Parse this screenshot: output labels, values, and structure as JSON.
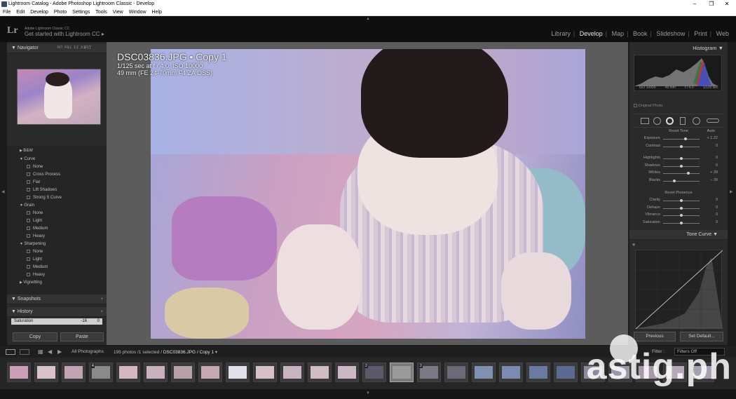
{
  "window": {
    "title": "Lightroom Catalog - Adobe Photoshop Lightroom Classic - Develop",
    "controls": [
      "–",
      "❐",
      "✕"
    ]
  },
  "menu": [
    "File",
    "Edit",
    "Develop",
    "Photo",
    "Settings",
    "Tools",
    "View",
    "Window",
    "Help"
  ],
  "identity": {
    "logo": "Lr",
    "line1": "Adobe Lightroom Classic CC",
    "line2": "Get started with Lightroom CC ▸"
  },
  "modules": [
    {
      "label": "Library",
      "active": false
    },
    {
      "label": "Develop",
      "active": true
    },
    {
      "label": "Map",
      "active": false
    },
    {
      "label": "Book",
      "active": false
    },
    {
      "label": "Slideshow",
      "active": false
    },
    {
      "label": "Print",
      "active": false
    },
    {
      "label": "Web",
      "active": false
    }
  ],
  "navigator": {
    "title": "Navigator",
    "zoom": [
      "FIT",
      "FILL",
      "1:1",
      "3:1"
    ]
  },
  "presets": [
    {
      "label": "B&W",
      "type": "folder",
      "open": false
    },
    {
      "label": "Curve",
      "type": "folder",
      "open": true
    },
    {
      "label": "None",
      "type": "item"
    },
    {
      "label": "Cross Process",
      "type": "item"
    },
    {
      "label": "Flat",
      "type": "item"
    },
    {
      "label": "Lift Shadows",
      "type": "item"
    },
    {
      "label": "Strong S Curve",
      "type": "item"
    },
    {
      "label": "Grain",
      "type": "folder",
      "open": true
    },
    {
      "label": "None",
      "type": "item"
    },
    {
      "label": "Light",
      "type": "item"
    },
    {
      "label": "Medium",
      "type": "item"
    },
    {
      "label": "Heavy",
      "type": "item"
    },
    {
      "label": "Sharpening",
      "type": "folder",
      "open": true
    },
    {
      "label": "None",
      "type": "item"
    },
    {
      "label": "Light",
      "type": "item"
    },
    {
      "label": "Medium",
      "type": "item"
    },
    {
      "label": "Heavy",
      "type": "item"
    },
    {
      "label": "Vignetting",
      "type": "folder",
      "open": false
    }
  ],
  "snapshots": {
    "title": "Snapshots",
    "action": "+"
  },
  "history": {
    "title": "History",
    "action": "×",
    "item": "Saturation",
    "val1": "-16",
    "val2": "0"
  },
  "buttons": {
    "copy": "Copy",
    "paste": "Paste"
  },
  "image": {
    "filename": "DSC03836.JPG • Copy 1",
    "exposure": "1/125 sec at f / 4.0, ISO 10000",
    "lens": "49 mm (FE 24-70mm F4 ZA OSS)"
  },
  "histogram": {
    "title": "Histogram",
    "iso": "ISO 10000",
    "focal": "49 mm",
    "fstop": "f / 4.0",
    "shutter": "1/125 sec",
    "original_photo": "Original Photo"
  },
  "basic": {
    "reset_tone": "Reset Tone",
    "auto": "Auto",
    "tone": [
      {
        "label": "Exposure",
        "value": "+ 1.22",
        "pos": 0.62
      },
      {
        "label": "Contrast",
        "value": "0",
        "pos": 0.5
      },
      {
        "label": "Highlights",
        "value": "0",
        "pos": 0.5
      },
      {
        "label": "Shadows",
        "value": "0",
        "pos": 0.5
      },
      {
        "label": "Whites",
        "value": "+ 39",
        "pos": 0.7
      },
      {
        "label": "Blacks",
        "value": "– 39",
        "pos": 0.3
      }
    ],
    "reset_presence": "Reset Presence",
    "presence": [
      {
        "label": "Clarity",
        "value": "0",
        "pos": 0.5
      },
      {
        "label": "Dehaze",
        "value": "0",
        "pos": 0.5
      },
      {
        "label": "Vibrance",
        "value": "0",
        "pos": 0.5
      },
      {
        "label": "Saturation",
        "value": "0",
        "pos": 0.5
      }
    ]
  },
  "tone_curve": {
    "title": "Tone Curve"
  },
  "right_buttons": {
    "previous": "Previous",
    "set_default": "Set Default..."
  },
  "filmbar": {
    "source": "All Photographs",
    "count": "195 photos /1 selected /",
    "current": "DSC03836.JPG / Copy 1",
    "filter_label": "Filter :",
    "filter_value": "Filters Off"
  },
  "filmstrip": {
    "badges": [
      "4",
      "2",
      "2"
    ]
  },
  "watermark": "astig.ph"
}
